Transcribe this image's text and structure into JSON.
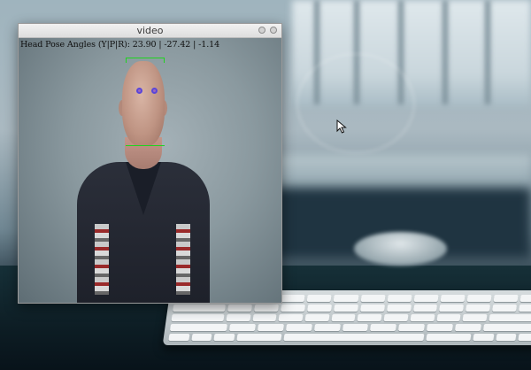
{
  "window": {
    "title": "video"
  },
  "video": {
    "overlay_text": "Head Pose Angles (Y|P|R): 23.90 | -27.42 | -1.14"
  },
  "icons": {
    "maximize": "maximize-icon",
    "close": "close-icon",
    "cursor": "mouse-pointer-icon"
  },
  "colors": {
    "pose_box": "#1fd41f",
    "eye_marker": "#5a46d9"
  }
}
